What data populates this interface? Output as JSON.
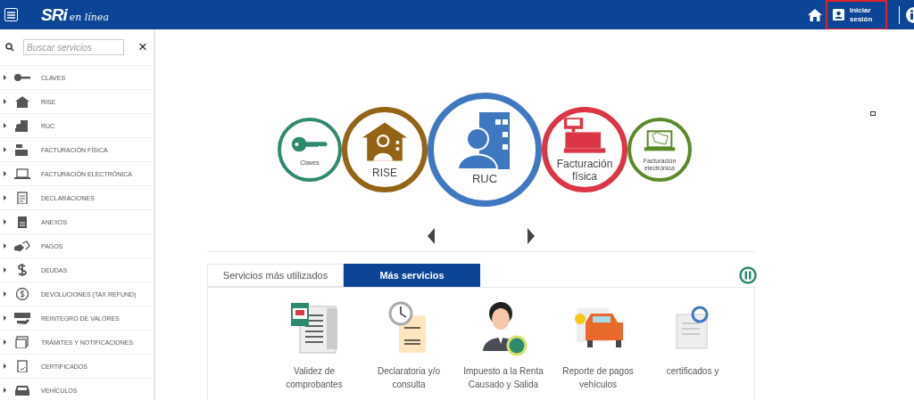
{
  "header": {
    "logo": "SRi",
    "logo_tagline": "en línea",
    "login_button": "Iniciar sesión"
  },
  "sidebar": {
    "search_placeholder": "Buscar servicios",
    "close": "×",
    "items": [
      {
        "label": "CLAVES"
      },
      {
        "label": "RISE"
      },
      {
        "label": "RUC"
      },
      {
        "label": "FACTURACIÓN FÍSICA"
      },
      {
        "label": "FACTURACIÓN ELECTRÓNICA"
      },
      {
        "label": "DECLARACIONES"
      },
      {
        "label": "ANEXOS"
      },
      {
        "label": "PAGOS"
      },
      {
        "label": "DEUDAS"
      },
      {
        "label": "DEVOLUCIONES (TAX REFUND)"
      },
      {
        "label": "REINTEGRO DE VALORES"
      },
      {
        "label": "TRÁMITES Y NOTIFICACIONES"
      },
      {
        "label": "CERTIFICADOS"
      },
      {
        "label": "VEHÍCULOS"
      }
    ]
  },
  "carousel": {
    "items": [
      {
        "label": "Claves",
        "color": "#2e8a6e",
        "selected": false
      },
      {
        "label": "RISE",
        "color": "#946416",
        "selected": false
      },
      {
        "label": "RUC",
        "color": "#3f78c0",
        "selected": true
      },
      {
        "label": "Facturación física",
        "color": "#dc3545",
        "selected": false
      },
      {
        "label": "Facturación electrónica",
        "color": "#5a8a2a",
        "selected": false
      }
    ]
  },
  "tabs": [
    {
      "label": "Servicios más utilizados",
      "selected": false
    },
    {
      "label": "Más servicios",
      "selected": true
    }
  ],
  "services": [
    {
      "label": "Validez de comprobantes"
    },
    {
      "label": "Declaratoria y/o consulta"
    },
    {
      "label": "Impuesto a la Renta Causado y Salida"
    },
    {
      "label": "Reporte de pagos vehículos"
    },
    {
      "label": "certificados y"
    }
  ]
}
